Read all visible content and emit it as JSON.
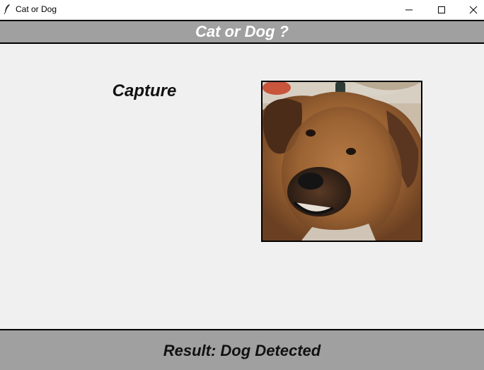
{
  "window": {
    "title": "Cat or Dog",
    "icon": "feather-icon",
    "controls": [
      "minimize-icon",
      "maximize-icon",
      "close-icon"
    ]
  },
  "header": {
    "title": "Cat or Dog ?"
  },
  "main": {
    "capture_label": "Capture",
    "preview": {
      "content": "dog-photo"
    }
  },
  "footer": {
    "result": "Result: Dog Detected"
  },
  "colors": {
    "bar_background": "#a0a0a0",
    "window_background": "#f0f0f0",
    "header_text": "#ffffff",
    "border": "#000000"
  }
}
